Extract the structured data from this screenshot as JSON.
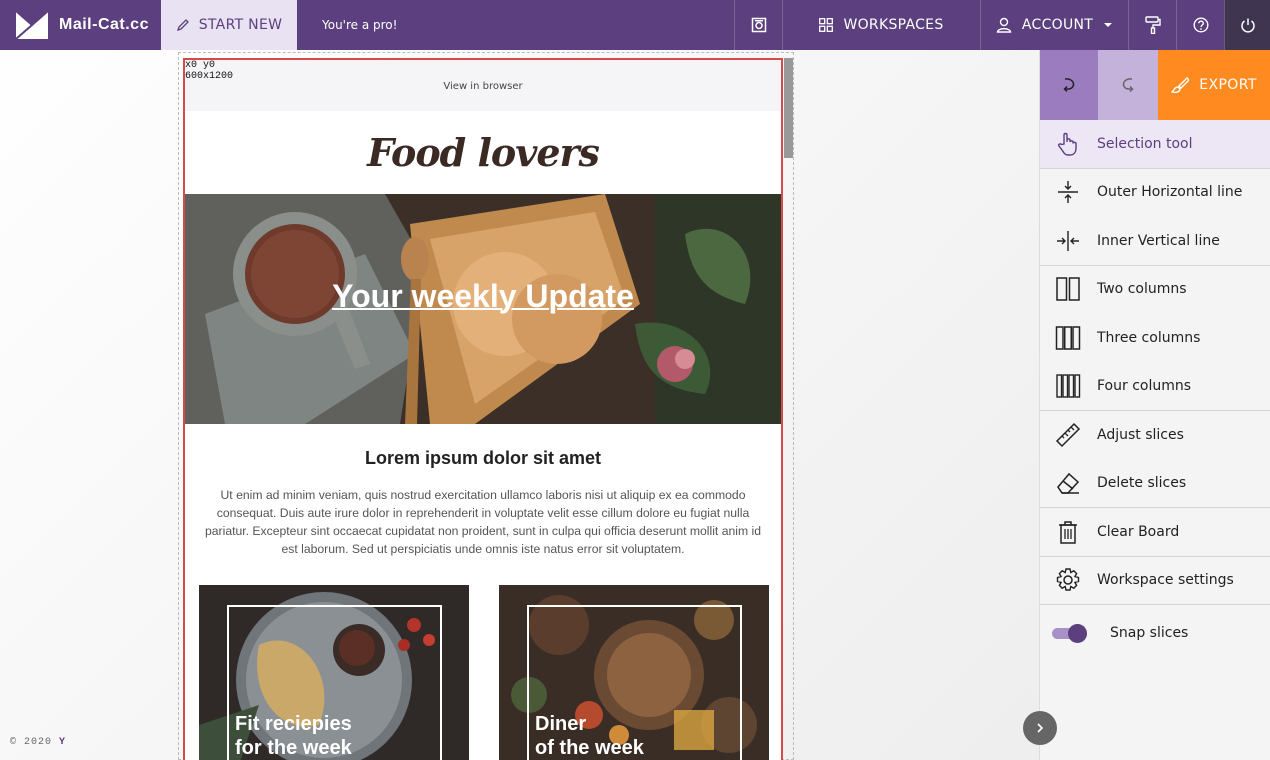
{
  "brand": {
    "name": "Mail-Cat.cc"
  },
  "topbar": {
    "start_new": "START NEW",
    "status": "You're a pro!",
    "workspaces": "WORKSPACES",
    "account": "ACCOUNT"
  },
  "canvas": {
    "coords_line1": "x0 y0",
    "coords_line2": "600x1200"
  },
  "email": {
    "view_in_browser": "View in browser",
    "brand_title": "Food lovers",
    "hero_title": "Your weekly Update",
    "intro_heading": "Lorem ipsum dolor sit amet",
    "intro_body": "Ut enim ad minim veniam, quis nostrud exercitation ullamco laboris nisi ut aliquip ex ea commodo consequat. Duis aute irure dolor in reprehenderit in voluptate velit esse cillum dolore eu fugiat nulla pariatur. Excepteur sint occaecat cupidatat non proident, sunt in culpa qui officia deserunt mollit anim id est laborum. Sed ut perspiciatis unde omnis iste natus error sit voluptatem.",
    "cards": [
      {
        "title": "Fit reciepies\nfor the week"
      },
      {
        "title": "Diner\nof the week"
      }
    ]
  },
  "panel": {
    "export": "EXPORT",
    "tools": [
      {
        "label": "Selection tool",
        "icon": "hand-pointer-icon"
      },
      {
        "label": "Outer Horizontal line",
        "icon": "horizontal-split-icon"
      },
      {
        "label": "Inner Vertical line",
        "icon": "vertical-split-icon"
      },
      {
        "label": "Two columns",
        "icon": "two-columns-icon"
      },
      {
        "label": "Three columns",
        "icon": "three-columns-icon"
      },
      {
        "label": "Four columns",
        "icon": "four-columns-icon"
      },
      {
        "label": "Adjust slices",
        "icon": "ruler-icon"
      },
      {
        "label": "Delete slices",
        "icon": "eraser-icon"
      },
      {
        "label": "Clear Board",
        "icon": "trash-icon"
      },
      {
        "label": "Workspace settings",
        "icon": "gear-icon"
      },
      {
        "label": "Snap slices",
        "icon": "toggle-switch"
      }
    ],
    "snap_enabled": true
  },
  "footer": {
    "copyright": "© 2020",
    "mark": "Y"
  },
  "colors": {
    "primary": "#5b3f7e",
    "accent": "#ff8a1f",
    "selection_border": "#d84a4a"
  }
}
